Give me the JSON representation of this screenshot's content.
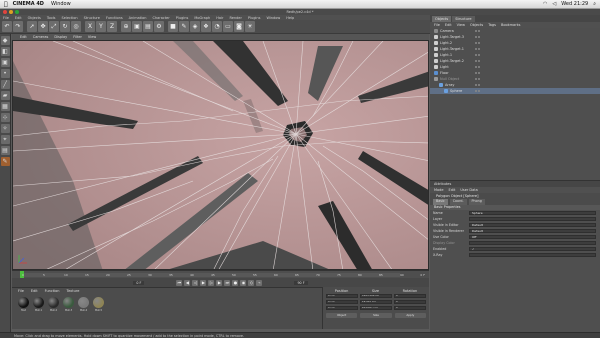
{
  "mac_menubar": {
    "app_name": "CINEMA 4D",
    "items": [
      "Window"
    ],
    "clock": "Wed 21:29"
  },
  "window": {
    "title": "Redh/pe2.c4d *"
  },
  "app_menu": [
    "File",
    "Edit",
    "Objects",
    "Tools",
    "Selection",
    "Structure",
    "Functions",
    "Animation",
    "Character",
    "Plugins",
    "MoGraph",
    "Hair",
    "Render",
    "Plugins",
    "Window",
    "Help"
  ],
  "toolbar_icons": [
    "undo-icon",
    "redo-icon",
    "live-select-icon",
    "move-icon",
    "scale-icon",
    "rotate-icon",
    "recent-icon",
    "x-axis-icon",
    "y-axis-icon",
    "z-axis-icon",
    "coord-system-icon",
    "render-view-icon",
    "render-picture-icon",
    "render-settings-icon",
    "cube-icon",
    "pen-icon",
    "subdivision-icon",
    "array-icon",
    "deformer-icon",
    "floor-icon",
    "camera-icon",
    "light-icon"
  ],
  "left_palette_icons": [
    "make-editable-icon",
    "model-mode-icon",
    "object-mode-icon",
    "point-mode-icon",
    "edge-mode-icon",
    "polygon-mode-icon",
    "texture-mode-icon",
    "axis-mode-icon",
    "tweak-mode-icon",
    "snap-icon",
    "workplane-icon",
    "brush-icon"
  ],
  "viewport": {
    "menu": [
      "Edit",
      "Cameras",
      "Display",
      "Filter",
      "View"
    ],
    "axis_label": "x"
  },
  "timeline": {
    "ticks": [
      "0",
      "5",
      "10",
      "15",
      "20",
      "25",
      "30",
      "35",
      "40",
      "45",
      "50",
      "55",
      "60",
      "65",
      "70",
      "75",
      "80",
      "85",
      "90"
    ],
    "end_frame": "0 F",
    "playhead_fraction": 0.0
  },
  "transport": {
    "start_field": "0 F",
    "end_field": "90 F",
    "buttons": [
      "first-frame",
      "prev-key",
      "prev-frame",
      "play",
      "next-frame",
      "next-key",
      "last-frame",
      "record",
      "auto-key",
      "keyframe-sel",
      "motion-path"
    ]
  },
  "materials": {
    "tab": "Materials",
    "menu": [
      "File",
      "Edit",
      "Function",
      "Texture"
    ],
    "items": [
      {
        "name": "Mat",
        "color": "#111111"
      },
      {
        "name": "Mat.1",
        "color": "#1a1a1a"
      },
      {
        "name": "Mat.2",
        "color": "#2a2a2a"
      },
      {
        "name": "Mat.3",
        "color": "#3a5a3e"
      },
      {
        "name": "Mat.4",
        "color": "#7a7a7a"
      },
      {
        "name": "Mat.5",
        "color": "#8e8455"
      }
    ]
  },
  "coordinates": {
    "tab": "Coordinates",
    "headers": [
      "Position",
      "Size",
      "Rotation"
    ],
    "rows": [
      {
        "axis": "X",
        "pos": "0 cm",
        "size": "1695.106 cm",
        "rot": "0 °"
      },
      {
        "axis": "Y",
        "pos": "0 cm",
        "size": "29.903 cm",
        "rot": "0 °"
      },
      {
        "axis": "Z",
        "pos": "0 cm",
        "size": "2014.67 cm",
        "rot": "0 °"
      }
    ],
    "mode": "Object",
    "size_mode": "Size",
    "apply_label": "Apply"
  },
  "object_manager": {
    "tabs": [
      "Objects",
      "Structure"
    ],
    "menu": [
      "File",
      "Edit",
      "View",
      "Objects",
      "Tags",
      "Bookmarks"
    ],
    "objects": [
      {
        "name": "Camera",
        "icon_color": "#8a8a8a",
        "indent": 0
      },
      {
        "name": "Light.Target.3",
        "icon_color": "#cfcfcf",
        "indent": 0
      },
      {
        "name": "Light.2",
        "icon_color": "#cfcfcf",
        "indent": 0
      },
      {
        "name": "Light.Target.1",
        "icon_color": "#cfcfcf",
        "indent": 0
      },
      {
        "name": "Light.1",
        "icon_color": "#cfcfcf",
        "indent": 0
      },
      {
        "name": "Light.Target.2",
        "icon_color": "#cfcfcf",
        "indent": 0
      },
      {
        "name": "Light",
        "icon_color": "#cfcfcf",
        "indent": 0
      },
      {
        "name": "Floor",
        "icon_color": "#5a8fd0",
        "indent": 0
      },
      {
        "name": "Null Object",
        "icon_color": "#9a9a9a",
        "indent": 0
      },
      {
        "name": "Array",
        "icon_color": "#6aa0e0",
        "indent": 1
      },
      {
        "name": "Sphere",
        "icon_color": "#6aa0e0",
        "indent": 2
      }
    ],
    "selected_index": 10
  },
  "attributes": {
    "tab": "Attributes",
    "menu": [
      "Mode",
      "Edit",
      "User Data"
    ],
    "title": "Polygon Object [Sphere]",
    "subtabs": [
      "Basic",
      "Coord.",
      "Phong"
    ],
    "section": "Basic Properties",
    "rows": [
      {
        "label": "Name",
        "value": "Sphere"
      },
      {
        "label": "Layer",
        "value": ""
      },
      {
        "label": "Visible in Editor",
        "value": "Default"
      },
      {
        "label": "Visible in Renderer",
        "value": "Default"
      },
      {
        "label": "Use Color",
        "value": "Off"
      },
      {
        "label": "Display Color",
        "value": "",
        "dim": true
      },
      {
        "label": "Enabled",
        "value": "✓"
      },
      {
        "label": "X-Ray",
        "value": ""
      }
    ]
  },
  "status": {
    "text": "Move: Click and drag to move elements. Hold down SHIFT to quantize movement / add to the selection in point mode, CTRL to remove."
  }
}
